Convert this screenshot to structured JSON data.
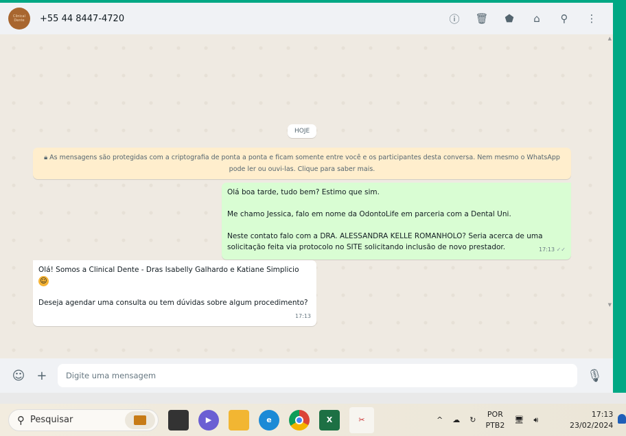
{
  "header": {
    "contact": "+55 44 8447-4720",
    "avatar_text": "Clinical Dente"
  },
  "chat": {
    "date_label": "HOJE",
    "encryption_notice": "As mensagens são protegidas com a criptografia de ponta a ponta e ficam somente entre você e os participantes desta conversa. Nem mesmo o WhatsApp pode ler ou ouvi-las. Clique para saber mais.",
    "messages": [
      {
        "direction": "out",
        "lines": [
          "Olá boa tarde, tudo bem? Estimo que sim.",
          "",
          "Me chamo Jessica, falo em nome da OdontoLife em parceria com a Dental Uni.",
          "",
          "Neste contato falo com a DRA. ALESSANDRA KELLE ROMANHOLO? Seria acerca de uma solicitação feita via protocolo no SITE solicitando inclusão de novo prestador."
        ],
        "time": "17:13",
        "status": "✓✓"
      },
      {
        "direction": "in",
        "lines": [
          "Olá! Somos a Clinical Dente - Dras Isabelly Galhardo e Katiane Simplicio",
          "",
          "Deseja agendar uma consulta ou tem dúvidas sobre algum procedimento?"
        ],
        "time": "17:13",
        "emoji": "😊"
      }
    ]
  },
  "footer": {
    "placeholder": "Digite uma mensagem"
  },
  "taskbar": {
    "search": "Pesquisar",
    "lang1": "POR",
    "lang2": "PTB2",
    "time": "17:13",
    "date": "23/02/2024"
  },
  "colors": {
    "accent": "#00a884",
    "outgoing": "#d9fdd3",
    "notice": "#ffeecd"
  }
}
